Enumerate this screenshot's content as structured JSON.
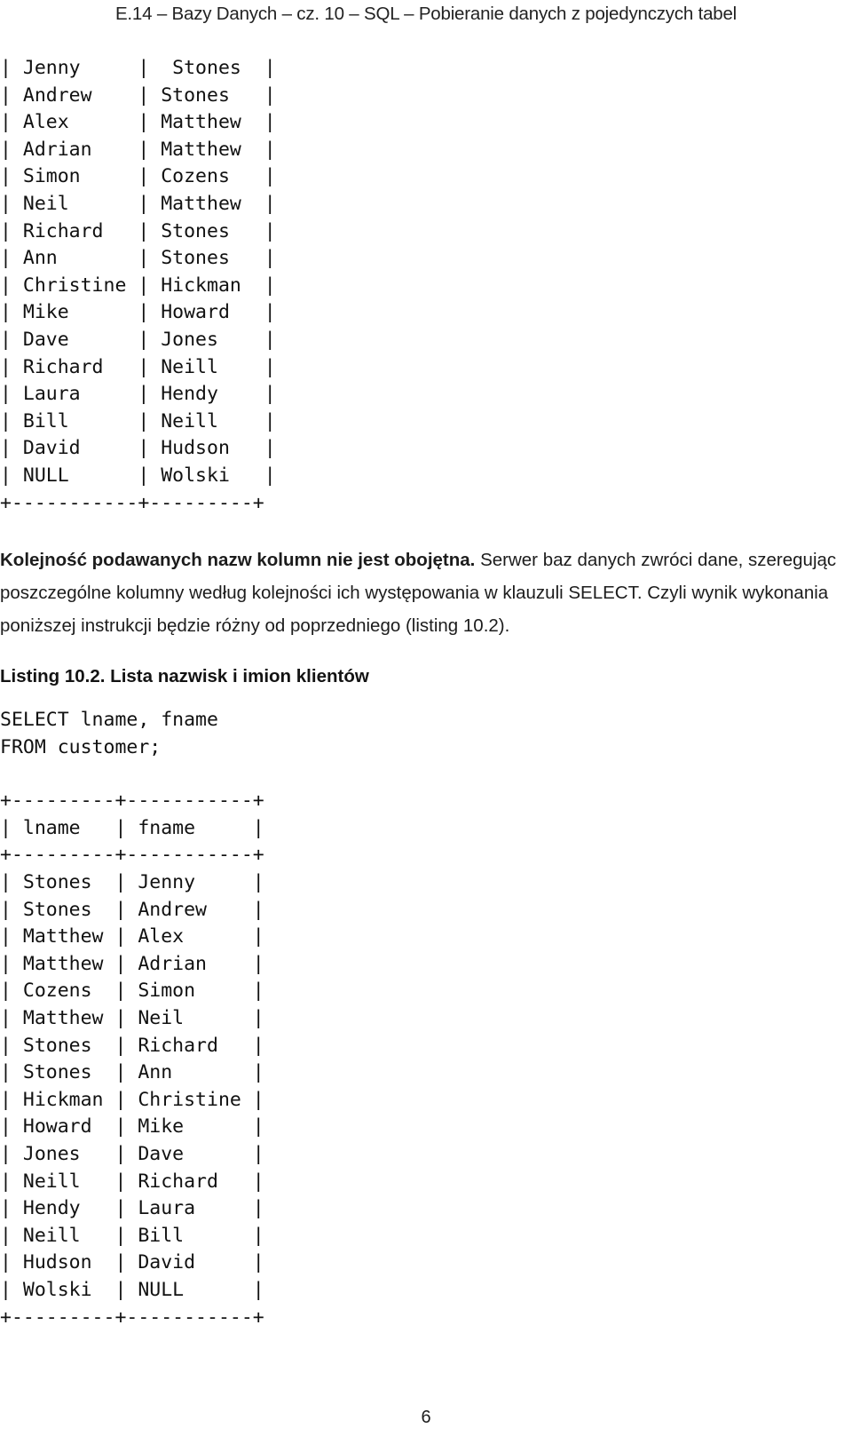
{
  "header": {
    "running_head": "E.14 – Bazy Danych – cz. 10 – SQL – Pobieranie danych z pojedynczych tabel"
  },
  "result_table_1": {
    "rows": [
      "| Jenny     |  Stones  |",
      "| Andrew    | Stones   |",
      "| Alex      | Matthew  |",
      "| Adrian    | Matthew  |",
      "| Simon     | Cozens   |",
      "| Neil      | Matthew  |",
      "| Richard   | Stones   |",
      "| Ann       | Stones   |",
      "| Christine | Hickman  |",
      "| Mike      | Howard   |",
      "| Dave      | Jones    |",
      "| Richard   | Neill    |",
      "| Laura     | Hendy    |",
      "| Bill      | Neill    |",
      "| David     | Hudson   |",
      "| NULL      | Wolski   |",
      "+-----------+---------+"
    ]
  },
  "paragraph": {
    "bold_lead": "Kolejność podawanych nazw kolumn nie jest obojętna.",
    "rest": " Serwer baz danych zwróci dane, szeregując poszczególne kolumny według kolejności ich występowania w klauzuli SELECT. Czyli wynik wykonania poniższej instrukcji będzie różny od poprzedniego (listing 10.2)."
  },
  "listing": {
    "title": "Listing 10.2. Lista nazwisk i imion klientów",
    "code": [
      "SELECT lname, fname",
      "FROM customer;"
    ]
  },
  "result_table_2": {
    "rows": [
      "+---------+-----------+",
      "| lname   | fname     |",
      "+---------+-----------+",
      "| Stones  | Jenny     |",
      "| Stones  | Andrew    |",
      "| Matthew | Alex      |",
      "| Matthew | Adrian    |",
      "| Cozens  | Simon     |",
      "| Matthew | Neil      |",
      "| Stones  | Richard   |",
      "| Stones  | Ann       |",
      "| Hickman | Christine |",
      "| Howard  | Mike      |",
      "| Jones   | Dave      |",
      "| Neill   | Richard   |",
      "| Hendy   | Laura     |",
      "| Neill   | Bill      |",
      "| Hudson  | David     |",
      "| Wolski  | NULL      |",
      "+---------+-----------+"
    ]
  },
  "footer": {
    "page_number": "6"
  },
  "colors": {
    "text": "#1a1a1a",
    "background": "#ffffff"
  }
}
